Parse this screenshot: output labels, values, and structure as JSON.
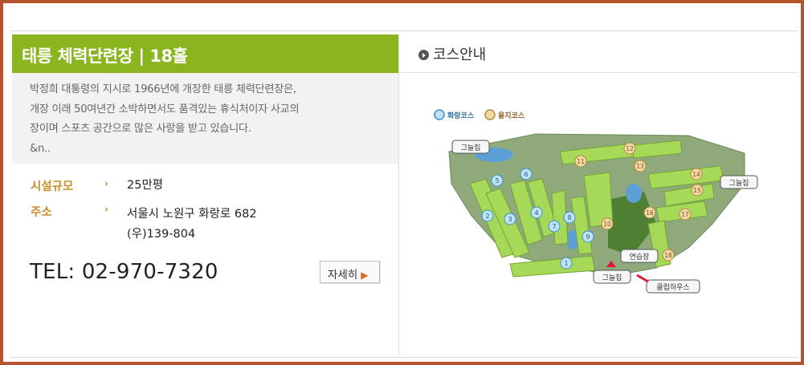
{
  "title": "태릉 체력단련장 | 18홀",
  "description_lines": [
    "박정희 대통령의 지시로 1966년에 개장한 태릉 체력단련장은,",
    "개장 이래 50여년간 소박하면서도 품격있는 휴식처이자 사교의",
    "장이며 스포츠 공간으로 많은 사랑을 받고 있습니다.",
    "&n.."
  ],
  "info": {
    "facility_label": "시설규모",
    "facility_value": "25만평",
    "address_label": "주소",
    "address_line1": "서울시 노원구 화랑로 682",
    "address_line2": "(우)139-804",
    "arrow": "›"
  },
  "tel": "TEL: 02-970-7320",
  "detail_button": "자세히",
  "course_header": "코스안내",
  "map": {
    "legend_hwarang": "화랑코스",
    "legend_eulji": "을지코스",
    "label_shade_tl": "그늘집",
    "label_shade_r": "그늘집",
    "label_shade_b": "그늘집",
    "label_practice": "연습장",
    "label_clubhouse": "클럽하우스",
    "holes_blue": [
      "1",
      "2",
      "3",
      "4",
      "5",
      "6",
      "7",
      "8",
      "9"
    ],
    "holes_orange": [
      "10",
      "11",
      "12",
      "13",
      "14",
      "15",
      "16",
      "17",
      "18"
    ],
    "colors": {
      "green": "#8ab51f",
      "blue_hole": "#bfe3f5",
      "orange_hole": "#f4d9a8",
      "border": "#b5532e"
    }
  }
}
